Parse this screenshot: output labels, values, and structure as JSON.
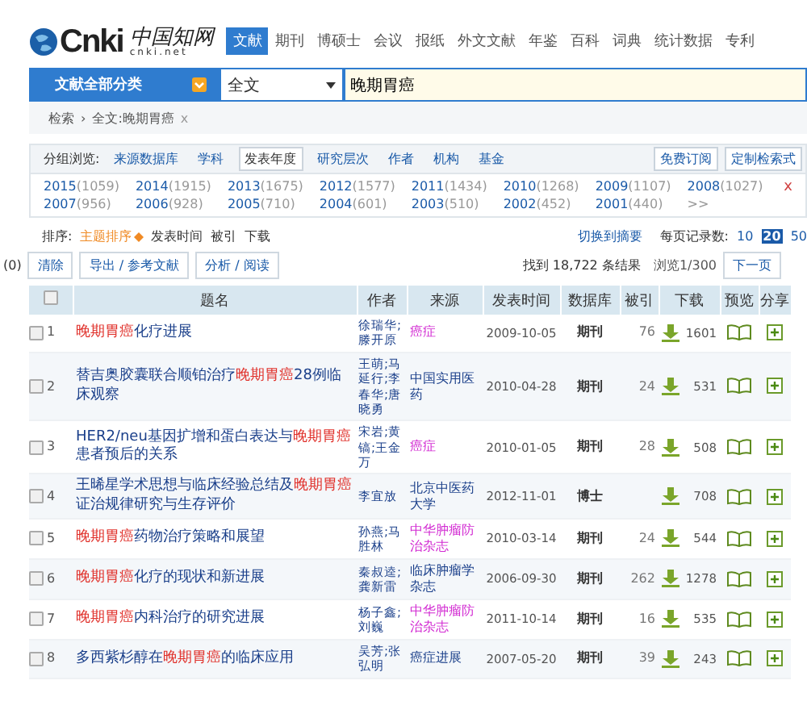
{
  "logo": {
    "mark": "Cnki",
    "chinese": "中国知网",
    "domain": "cnki.net"
  },
  "nav": [
    {
      "label": "文献",
      "selected": true
    },
    {
      "label": "期刊",
      "selected": false
    },
    {
      "label": "博硕士",
      "selected": false
    },
    {
      "label": "会议",
      "selected": false
    },
    {
      "label": "报纸",
      "selected": false
    },
    {
      "label": "外文文献",
      "selected": false
    },
    {
      "label": "年鉴",
      "selected": false
    },
    {
      "label": "百科",
      "selected": false
    },
    {
      "label": "词典",
      "selected": false
    },
    {
      "label": "统计数据",
      "selected": false
    },
    {
      "label": "专利",
      "selected": false
    }
  ],
  "search": {
    "category": "文献全部分类",
    "field": "全文",
    "value": "晚期胃癌"
  },
  "breadcrumb": {
    "root": "检索",
    "separator": "›",
    "term": "全文:晚期胃癌",
    "remove": "x"
  },
  "grouping": {
    "label": "分组浏览:",
    "tabs": [
      {
        "label": "来源数据库",
        "selected": false
      },
      {
        "label": "学科",
        "selected": false
      },
      {
        "label": "发表年度",
        "selected": true
      },
      {
        "label": "研究层次",
        "selected": false
      },
      {
        "label": "作者",
        "selected": false
      },
      {
        "label": "机构",
        "selected": false
      },
      {
        "label": "基金",
        "selected": false
      }
    ],
    "buttons": [
      "免费订阅",
      "定制检索式"
    ]
  },
  "years": [
    {
      "year": "2015",
      "count": "(1059)"
    },
    {
      "year": "2014",
      "count": "(1915)"
    },
    {
      "year": "2013",
      "count": "(1675)"
    },
    {
      "year": "2012",
      "count": "(1577)"
    },
    {
      "year": "2011",
      "count": "(1434)"
    },
    {
      "year": "2010",
      "count": "(1268)"
    },
    {
      "year": "2009",
      "count": "(1107)"
    },
    {
      "year": "2008",
      "count": "(1027)"
    },
    {
      "year": "2007",
      "count": "(956)"
    },
    {
      "year": "2006",
      "count": "(928)"
    },
    {
      "year": "2005",
      "count": "(710)"
    },
    {
      "year": "2004",
      "count": "(601)"
    },
    {
      "year": "2003",
      "count": "(510)"
    },
    {
      "year": "2002",
      "count": "(452)"
    },
    {
      "year": "2001",
      "count": "(440)"
    }
  ],
  "years_more": ">>",
  "years_close": "x",
  "sort": {
    "label": "排序:",
    "options": [
      {
        "label": "主题排序",
        "selected": true
      },
      {
        "label": "发表时间",
        "selected": false
      },
      {
        "label": "被引",
        "selected": false
      },
      {
        "label": "下载",
        "selected": false
      }
    ],
    "switch_link": "切换到摘要",
    "per_page_label": "每页记录数:",
    "per_page": [
      {
        "label": "10",
        "selected": false
      },
      {
        "label": "20",
        "selected": true
      },
      {
        "label": "50",
        "selected": false
      }
    ]
  },
  "toolbar": {
    "selected_count": "(0)",
    "buttons": [
      "清除",
      "导出 / 参考文献",
      "分析 / 阅读"
    ],
    "found": "找到 18,722 条结果",
    "page": "浏览1/300",
    "next": "下一页"
  },
  "table": {
    "select_all": false,
    "columns": [
      "题名",
      "作者",
      "来源",
      "发表时间",
      "数据库",
      "被引",
      "下载",
      "预览",
      "分享"
    ],
    "rows": [
      {
        "checked": false,
        "no": "1",
        "title": [
          {
            "text": "晚期胃癌",
            "hit": true
          },
          {
            "text": "化疗进展",
            "hit": false
          }
        ],
        "author": "徐瑞华;滕开原",
        "source": "癌症",
        "source_highlight": true,
        "date": "2009-10-05",
        "db": "期刊",
        "cited": "76",
        "downloads": "1601"
      },
      {
        "checked": false,
        "no": "2",
        "title": [
          {
            "text": "替吉奥胶囊联合顺铂治疗",
            "hit": false
          },
          {
            "text": "晚期胃癌",
            "hit": true
          },
          {
            "text": "28例临床观察",
            "hit": false
          }
        ],
        "author": "王萌;马延行;李春华;唐晓勇",
        "source": "中国实用医药",
        "source_highlight": false,
        "date": "2010-04-28",
        "db": "期刊",
        "cited": "24",
        "downloads": "531"
      },
      {
        "checked": false,
        "no": "3",
        "title": [
          {
            "text": "HER2/neu基因扩增和蛋白表达与",
            "hit": false
          },
          {
            "text": "晚期胃癌",
            "hit": true
          },
          {
            "text": "患者预后的关系",
            "hit": false
          }
        ],
        "author": "宋岩;黄镐;王金万",
        "source": "癌症",
        "source_highlight": true,
        "date": "2010-01-05",
        "db": "期刊",
        "cited": "28",
        "downloads": "508"
      },
      {
        "checked": false,
        "no": "4",
        "title": [
          {
            "text": "王晞星学术思想与临床经验总结及",
            "hit": false
          },
          {
            "text": "晚期胃癌",
            "hit": true
          },
          {
            "text": "证治规律研究与生存评价",
            "hit": false
          }
        ],
        "author": "李宜放",
        "source": "北京中医药大学",
        "source_highlight": false,
        "date": "2012-11-01",
        "db": "博士",
        "downloads": "708"
      },
      {
        "checked": false,
        "no": "5",
        "title": [
          {
            "text": "晚期胃癌",
            "hit": true
          },
          {
            "text": "药物治疗策略和展望",
            "hit": false
          }
        ],
        "author": "孙燕;马胜林",
        "source": "中华肿瘤防治杂志",
        "source_highlight": true,
        "date": "2010-03-14",
        "db": "期刊",
        "cited": "24",
        "downloads": "544"
      },
      {
        "checked": false,
        "no": "6",
        "title": [
          {
            "text": "晚期胃癌",
            "hit": true
          },
          {
            "text": "化疗的现状和新进展",
            "hit": false
          }
        ],
        "author": "秦叔逵;龚新雷",
        "source": "临床肿瘤学杂志",
        "source_highlight": false,
        "date": "2006-09-30",
        "db": "期刊",
        "cited": "262",
        "downloads": "1278"
      },
      {
        "checked": false,
        "no": "7",
        "title": [
          {
            "text": "晚期胃癌",
            "hit": true
          },
          {
            "text": "内科治疗的研究进展",
            "hit": false
          }
        ],
        "author": "杨子鑫;刘巍",
        "source": "中华肿瘤防治杂志",
        "source_highlight": true,
        "date": "2011-10-14",
        "db": "期刊",
        "cited": "16",
        "downloads": "535"
      },
      {
        "checked": false,
        "no": "8",
        "title": [
          {
            "text": "多西紫杉醇在",
            "hit": false
          },
          {
            "text": "晚期胃癌",
            "hit": true
          },
          {
            "text": "的临床应用",
            "hit": false
          }
        ],
        "author": "吴芳;张弘明",
        "source": "癌症进展",
        "source_highlight": false,
        "date": "2007-05-20",
        "db": "期刊",
        "cited": "39",
        "downloads": "243"
      }
    ]
  }
}
